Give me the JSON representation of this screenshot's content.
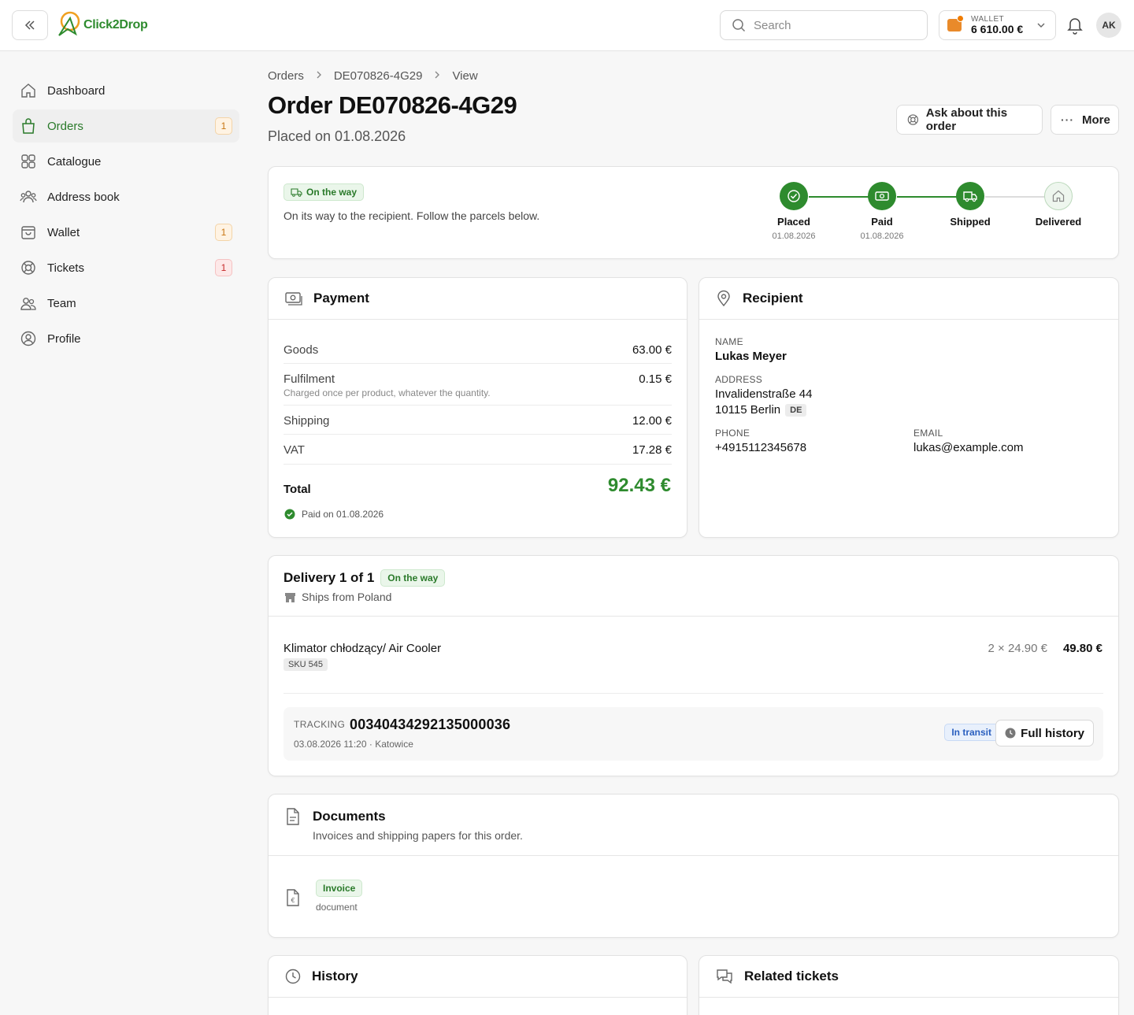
{
  "app": {
    "name": "Click2Drop",
    "search_placeholder": "Search",
    "wallet_label": "WALLET",
    "wallet_amount": "6 610.00 €",
    "avatar_initials": "AK",
    "accent_color": "#2e8b2e"
  },
  "sidebar": {
    "items": [
      {
        "label": "Dashboard",
        "icon": "home-icon"
      },
      {
        "label": "Orders",
        "icon": "shopping-bag-icon",
        "badge": "1",
        "active": true
      },
      {
        "label": "Catalogue",
        "icon": "grid-icon"
      },
      {
        "label": "Address book",
        "icon": "users-group-icon"
      },
      {
        "label": "Wallet",
        "icon": "wallet-icon",
        "badge": "1"
      },
      {
        "label": "Tickets",
        "icon": "lifebuoy-icon",
        "badge": "1"
      },
      {
        "label": "Team",
        "icon": "team-icon"
      },
      {
        "label": "Profile",
        "icon": "user-circle-icon"
      }
    ]
  },
  "breadcrumb": [
    "Orders",
    "DE070826-4G29",
    "View"
  ],
  "page": {
    "title": "Order DE070826-4G29",
    "subtitle": "Placed on 01.08.2026",
    "ask_button": "Ask about this order",
    "more_button": "More"
  },
  "status": {
    "pill": "On the way",
    "description": "On its way to the recipient. Follow the parcels below.",
    "steps": [
      {
        "label": "Placed",
        "date": "01.08.2026",
        "done": true
      },
      {
        "label": "Paid",
        "date": "01.08.2026",
        "done": true
      },
      {
        "label": "Shipped",
        "date": "",
        "done": true
      },
      {
        "label": "Delivered",
        "date": "",
        "done": false
      }
    ]
  },
  "payment": {
    "title": "Payment",
    "rows": [
      {
        "label": "Goods",
        "amount": "63.00 €"
      },
      {
        "label": "Fulfilment",
        "amount": "0.15 €",
        "note": "Charged once per product, whatever the quantity."
      },
      {
        "label": "Shipping",
        "amount": "12.00 €"
      },
      {
        "label": "VAT",
        "amount": "17.28 €"
      }
    ],
    "total_label": "Total",
    "total_amount": "92.43 €",
    "paid_on": "Paid on 01.08.2026"
  },
  "recipient": {
    "title": "Recipient",
    "name_label": "NAME",
    "name": "Lukas Meyer",
    "address_label": "ADDRESS",
    "street": "Invalidenstraße 44",
    "city": "10115 Berlin",
    "country": "DE",
    "phone_label": "PHONE",
    "phone": "+4915112345678",
    "email_label": "EMAIL",
    "email": "lukas@example.com"
  },
  "delivery": {
    "title": "Delivery 1 of 1",
    "pill": "On the way",
    "ships_from": "Ships from Poland",
    "product_name": "Klimator chłodzący/ Air Cooler",
    "sku": "SKU 545",
    "unit_price": "2 × 24.90 €",
    "line_total": "49.80 €",
    "tracking_label": "TRACKING",
    "tracking_number": "00340434292135000036",
    "tracking_sub": "03.08.2026 11:20 · Katowice",
    "tracking_status": "In transit",
    "history_button": "Full history"
  },
  "documents": {
    "title": "Documents",
    "subtitle": "Invoices and shipping papers for this order.",
    "doc_pill": "Invoice",
    "doc_sub": "document"
  },
  "history": {
    "title": "History"
  },
  "tickets": {
    "title": "Related tickets"
  }
}
